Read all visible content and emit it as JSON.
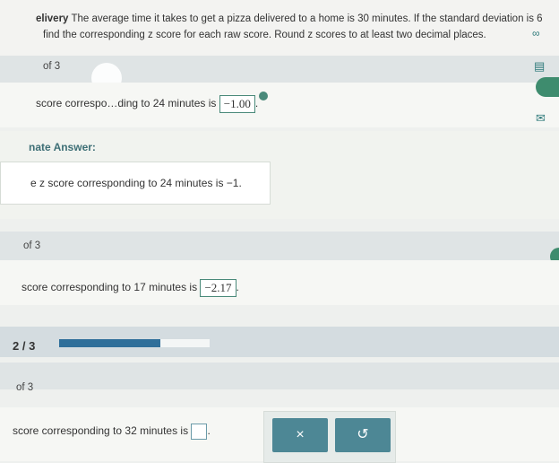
{
  "problem": {
    "title": "elivery",
    "line1": "The average time it takes to get a pizza delivered to a home is 30 minutes. If the standard deviation is 6",
    "line2": "find the corresponding z score for each raw score. Round z scores to at least two decimal places."
  },
  "part1": {
    "label": "of 3",
    "statement": "score correspo…ding to 24 minutes is",
    "answer": "−1.00",
    "period": "."
  },
  "alternate": {
    "heading": "nate Answer:",
    "text": "e z score corresponding to 24 minutes is −1."
  },
  "part2": {
    "label": "of 3",
    "statement": "score corresponding to 17 minutes is",
    "answer": "−2.17",
    "period": "."
  },
  "progress": {
    "text": "2 / 3",
    "fraction": 0.67
  },
  "part3": {
    "label": "of 3",
    "statement": "score corresponding to 32 minutes is",
    "period": "."
  },
  "buttons": {
    "clear": "×",
    "undo": "↺"
  },
  "icons": {
    "infinity": "∞"
  }
}
